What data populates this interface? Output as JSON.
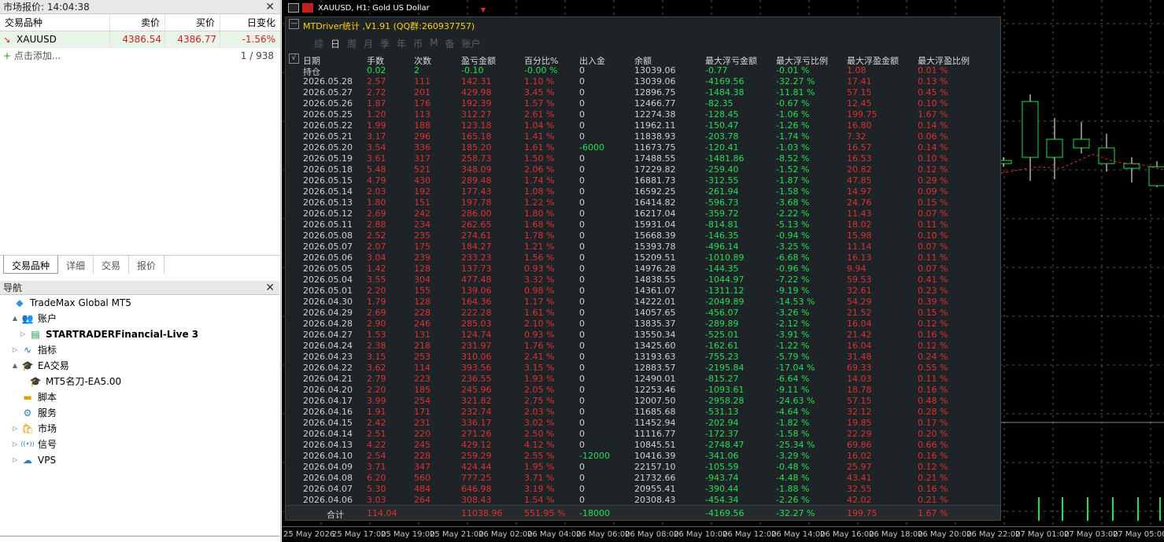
{
  "market_watch": {
    "title": "市场报价: 14:04:38",
    "columns": [
      "交易品种",
      "卖价",
      "买价",
      "日变化"
    ],
    "row": {
      "symbol": "XAUUSD",
      "bid": "4386.54",
      "ask": "4386.77",
      "change": "-1.56%"
    },
    "add_label": "点击添加...",
    "count": "1 / 938",
    "tabs": [
      "交易品种",
      "详细",
      "交易",
      "报价"
    ]
  },
  "navigator": {
    "title": "导航",
    "items": [
      {
        "label": "TradeMax Global MT5",
        "icon": "broker-icon",
        "indent": 0,
        "twisty": ""
      },
      {
        "label": "账户",
        "icon": "accounts-icon",
        "indent": 1,
        "twisty": "▲"
      },
      {
        "label": "STARTRADERFinancial-Live 3",
        "icon": "server-icon",
        "indent": 2,
        "twisty": "▷",
        "bold": true
      },
      {
        "label": "指标",
        "icon": "indicators-icon",
        "indent": 1,
        "twisty": "▷"
      },
      {
        "label": "EA交易",
        "icon": "expert-icon",
        "indent": 1,
        "twisty": "▲"
      },
      {
        "label": "MT5名刀-EA5.00",
        "icon": "expert-icon",
        "indent": 2,
        "twisty": ""
      },
      {
        "label": "脚本",
        "icon": "scripts-icon",
        "indent": 1,
        "twisty": ""
      },
      {
        "label": "服务",
        "icon": "services-icon",
        "indent": 1,
        "twisty": ""
      },
      {
        "label": "市场",
        "icon": "market-icon",
        "indent": 1,
        "twisty": "▷"
      },
      {
        "label": "信号",
        "icon": "signals-icon",
        "indent": 1,
        "twisty": "▷"
      },
      {
        "label": "VPS",
        "icon": "vps-icon",
        "indent": 1,
        "twisty": "▷"
      }
    ]
  },
  "chart": {
    "title": "XAUUSD, H1:  Gold US Dollar",
    "time_labels": [
      "25 May 2026",
      "25 May 17:00",
      "25 May 19:00",
      "25 May 21:00",
      "26 May 02:00",
      "26 May 04:00",
      "26 May 06:00",
      "26 May 08:00",
      "26 May 10:00",
      "26 May 12:00",
      "26 May 14:00",
      "26 May 16:00",
      "26 May 18:00",
      "26 May 20:00",
      "26 May 22:00",
      "27 May 01:00",
      "27 May 03:00",
      "27 May 05:00"
    ]
  },
  "stats": {
    "title": "MTDriver统计 ,V1.91 (QQ群:260937757)",
    "tabs": [
      "综",
      "日",
      "周",
      "月",
      "季",
      "年",
      "币",
      "M",
      "备",
      "账户"
    ],
    "active_tab": "日",
    "columns": [
      "日期",
      "手数",
      "次数",
      "盈亏金额",
      "百分比%",
      "出入金",
      "余额",
      "最大浮亏金额",
      "最大浮亏比例",
      "最大浮盈金额",
      "最大浮盈比例"
    ],
    "rows": [
      [
        "持仓",
        "0.02",
        "2",
        "-0.10",
        "-0.00 %",
        "0",
        "13039.06",
        "-0.77",
        "-0.01 %",
        "1.08",
        "0.01 %"
      ],
      [
        "2026.05.28",
        "2.57",
        "111",
        "142.31",
        "1.10 %",
        "0",
        "13039.06",
        "-4169.56",
        "-32.27 %",
        "17.41",
        "0.13 %"
      ],
      [
        "2026.05.27",
        "2.72",
        "201",
        "429.98",
        "3.45 %",
        "0",
        "12896.75",
        "-1484.38",
        "-11.81 %",
        "57.15",
        "0.45 %"
      ],
      [
        "2026.05.26",
        "1.87",
        "176",
        "192.39",
        "1.57 %",
        "0",
        "12466.77",
        "-82.35",
        "-0.67 %",
        "12.45",
        "0.10 %"
      ],
      [
        "2026.05.25",
        "1.20",
        "113",
        "312.27",
        "2.61 %",
        "0",
        "12274.38",
        "-128.45",
        "-1.06 %",
        "199.75",
        "1.67 %"
      ],
      [
        "2026.05.22",
        "1.99",
        "188",
        "123.18",
        "1.04 %",
        "0",
        "11962.11",
        "-150.47",
        "-1.26 %",
        "16.80",
        "0.14 %"
      ],
      [
        "2026.05.21",
        "3.17",
        "296",
        "165.18",
        "1.41 %",
        "0",
        "11838.93",
        "-203.78",
        "-1.74 %",
        "7.32",
        "0.06 %"
      ],
      [
        "2026.05.20",
        "3.54",
        "336",
        "185.20",
        "1.61 %",
        "-6000",
        "11673.75",
        "-120.41",
        "-1.03 %",
        "16.57",
        "0.14 %"
      ],
      [
        "2026.05.19",
        "3.61",
        "317",
        "258.73",
        "1.50 %",
        "0",
        "17488.55",
        "-1481.86",
        "-8.52 %",
        "16.53",
        "0.10 %"
      ],
      [
        "2026.05.18",
        "5.48",
        "521",
        "348.09",
        "2.06 %",
        "0",
        "17229.82",
        "-259.40",
        "-1.52 %",
        "20.82",
        "0.12 %"
      ],
      [
        "2026.05.15",
        "4.79",
        "430",
        "289.48",
        "1.74 %",
        "0",
        "16881.73",
        "-312.55",
        "-1.87 %",
        "47.85",
        "0.29 %"
      ],
      [
        "2026.05.14",
        "2.03",
        "192",
        "177.43",
        "1.08 %",
        "0",
        "16592.25",
        "-261.94",
        "-1.58 %",
        "14.97",
        "0.09 %"
      ],
      [
        "2026.05.13",
        "1.80",
        "151",
        "197.78",
        "1.22 %",
        "0",
        "16414.82",
        "-596.73",
        "-3.68 %",
        "24.76",
        "0.15 %"
      ],
      [
        "2026.05.12",
        "2.69",
        "242",
        "286.00",
        "1.80 %",
        "0",
        "16217.04",
        "-359.72",
        "-2.22 %",
        "11.43",
        "0.07 %"
      ],
      [
        "2026.05.11",
        "2.88",
        "234",
        "262.65",
        "1.68 %",
        "0",
        "15931.04",
        "-814.81",
        "-5.13 %",
        "18.02",
        "0.11 %"
      ],
      [
        "2026.05.08",
        "2.52",
        "235",
        "274.61",
        "1.78 %",
        "0",
        "15668.39",
        "-146.35",
        "-0.94 %",
        "15.98",
        "0.10 %"
      ],
      [
        "2026.05.07",
        "2.07",
        "175",
        "184.27",
        "1.21 %",
        "0",
        "15393.78",
        "-496.14",
        "-3.25 %",
        "11.14",
        "0.07 %"
      ],
      [
        "2026.05.06",
        "3.04",
        "239",
        "233.23",
        "1.56 %",
        "0",
        "15209.51",
        "-1010.89",
        "-6.68 %",
        "16.13",
        "0.11 %"
      ],
      [
        "2026.05.05",
        "1.42",
        "128",
        "137.73",
        "0.93 %",
        "0",
        "14976.28",
        "-144.35",
        "-0.96 %",
        "9.94",
        "0.07 %"
      ],
      [
        "2026.05.04",
        "3.55",
        "304",
        "477.48",
        "3.32 %",
        "0",
        "14838.55",
        "-1044.97",
        "-7.22 %",
        "59.53",
        "0.41 %"
      ],
      [
        "2026.05.01",
        "2.20",
        "155",
        "139.06",
        "0.98 %",
        "0",
        "14361.07",
        "-1311.12",
        "-9.19 %",
        "32.61",
        "0.23 %"
      ],
      [
        "2026.04.30",
        "1.79",
        "128",
        "164.36",
        "1.17 %",
        "0",
        "14222.01",
        "-2049.89",
        "-14.53 %",
        "54.29",
        "0.39 %"
      ],
      [
        "2026.04.29",
        "2.69",
        "228",
        "222.28",
        "1.61 %",
        "0",
        "14057.65",
        "-456.07",
        "-3.26 %",
        "21.52",
        "0.15 %"
      ],
      [
        "2026.04.28",
        "2.90",
        "246",
        "285.03",
        "2.10 %",
        "0",
        "13835.37",
        "-289.89",
        "-2.12 %",
        "16.04",
        "0.12 %"
      ],
      [
        "2026.04.27",
        "1.53",
        "131",
        "124.74",
        "0.93 %",
        "0",
        "13550.34",
        "-525.01",
        "-3.91 %",
        "21.42",
        "0.16 %"
      ],
      [
        "2026.04.24",
        "2.38",
        "218",
        "231.97",
        "1.76 %",
        "0",
        "13425.60",
        "-162.61",
        "-1.22 %",
        "16.04",
        "0.12 %"
      ],
      [
        "2026.04.23",
        "3.15",
        "253",
        "310.06",
        "2.41 %",
        "0",
        "13193.63",
        "-755.23",
        "-5.79 %",
        "31.48",
        "0.24 %"
      ],
      [
        "2026.04.22",
        "3.62",
        "114",
        "393.56",
        "3.15 %",
        "0",
        "12883.57",
        "-2195.84",
        "-17.04 %",
        "69.33",
        "0.55 %"
      ],
      [
        "2026.04.21",
        "2.79",
        "223",
        "236.55",
        "1.93 %",
        "0",
        "12490.01",
        "-815.27",
        "-6.64 %",
        "14.03",
        "0.11 %"
      ],
      [
        "2026.04.20",
        "2.20",
        "185",
        "245.96",
        "2.05 %",
        "0",
        "12253.46",
        "-1093.61",
        "-9.11 %",
        "18.78",
        "0.16 %"
      ],
      [
        "2026.04.17",
        "3.99",
        "254",
        "321.82",
        "2.75 %",
        "0",
        "12007.50",
        "-2958.28",
        "-24.63 %",
        "57.15",
        "0.48 %"
      ],
      [
        "2026.04.16",
        "1.91",
        "171",
        "232.74",
        "2.03 %",
        "0",
        "11685.68",
        "-531.13",
        "-4.64 %",
        "32.12",
        "0.28 %"
      ],
      [
        "2026.04.15",
        "2.42",
        "231",
        "336.17",
        "3.02 %",
        "0",
        "11452.94",
        "-202.94",
        "-1.82 %",
        "19.85",
        "0.17 %"
      ],
      [
        "2026.04.14",
        "2.51",
        "220",
        "271.26",
        "2.50 %",
        "0",
        "11116.77",
        "-172.37",
        "-1.58 %",
        "22.29",
        "0.20 %"
      ],
      [
        "2026.04.13",
        "4.22",
        "245",
        "429.12",
        "4.12 %",
        "0",
        "10845.51",
        "-2748.47",
        "-25.34 %",
        "69.86",
        "0.66 %"
      ],
      [
        "2026.04.10",
        "2.54",
        "228",
        "259.29",
        "2.55 %",
        "-12000",
        "10416.39",
        "-341.06",
        "-3.29 %",
        "16.02",
        "0.16 %"
      ],
      [
        "2026.04.09",
        "3.71",
        "347",
        "424.44",
        "1.95 %",
        "0",
        "22157.10",
        "-105.59",
        "-0.48 %",
        "25.97",
        "0.12 %"
      ],
      [
        "2026.04.08",
        "6.20",
        "560",
        "777.25",
        "3.71 %",
        "0",
        "21732.66",
        "-943.74",
        "-4.48 %",
        "43.41",
        "0.21 %"
      ],
      [
        "2026.04.07",
        "5.30",
        "484",
        "646.98",
        "3.19 %",
        "0",
        "20955.41",
        "-390.44",
        "-1.88 %",
        "32.55",
        "0.16 %"
      ],
      [
        "2026.04.06",
        "3.03",
        "264",
        "308.43",
        "1.54 %",
        "0",
        "20308.43",
        "-454.34",
        "-2.26 %",
        "42.02",
        "0.21 %"
      ]
    ],
    "footer": [
      "合计",
      "114.04",
      "",
      "11038.96",
      "551.95 %",
      "-18000",
      "",
      "-4169.56",
      "-32.27 %",
      "199.75",
      "1.67 %"
    ]
  },
  "colors": {
    "positive": "#e03030",
    "negative": "#21e050",
    "accent": "#ffd200"
  }
}
